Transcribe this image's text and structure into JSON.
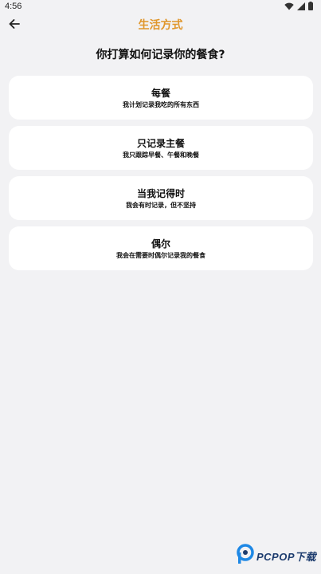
{
  "status_bar": {
    "time": "4:56"
  },
  "app_bar": {
    "title": "生活方式",
    "back_icon": "arrow-left-icon",
    "title_color": "#e0962b"
  },
  "question": "你打算如何记录你的餐食?",
  "options": [
    {
      "title": "每餐",
      "subtitle": "我计划记录我吃的所有东西"
    },
    {
      "title": "只记录主餐",
      "subtitle": "我只跟踪早餐、午餐和晚餐"
    },
    {
      "title": "当我记得时",
      "subtitle": "我会有时记录，但不坚持"
    },
    {
      "title": "偶尔",
      "subtitle": "我会在需要时偶尔记录我的餐食"
    }
  ],
  "watermark": {
    "text": "PCPOP下载"
  }
}
